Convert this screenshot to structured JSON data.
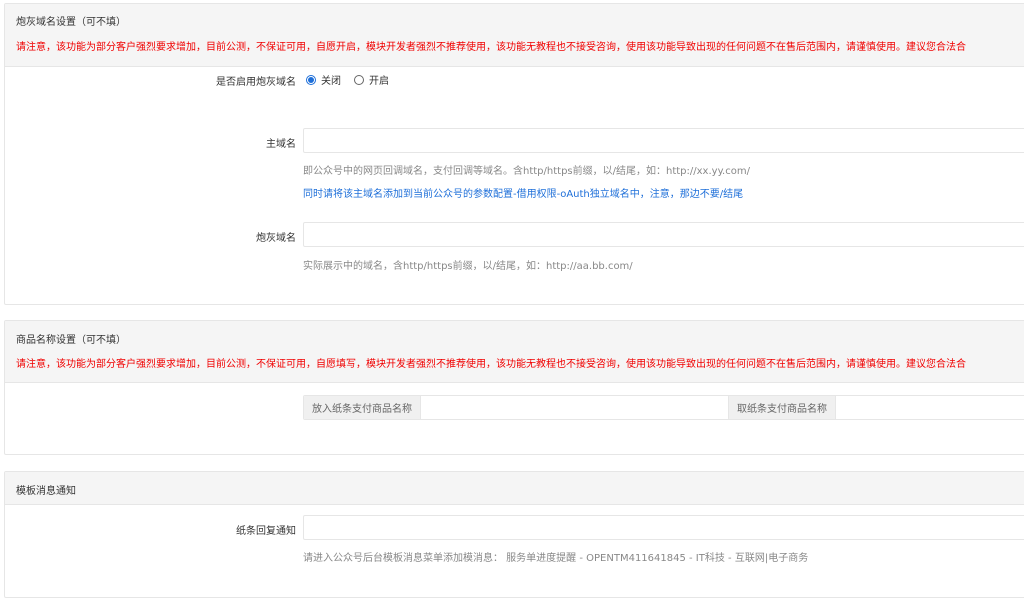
{
  "colors": {
    "warning": "#f00000",
    "note_blue": "#1e6fd9",
    "help_gray": "#888888",
    "header_bg": "#f5f5f5",
    "border": "#e6e6e6"
  },
  "panels": [
    {
      "title": "炮灰域名设置（可不填）",
      "warning": "请注意，该功能为部分客户强烈要求增加，目前公测，不保证可用，自愿开启，模块开发者强烈不推荐使用，该功能无教程也不接受咨询，使用该功能导致出现的任何问题不在售后范围内，请谨慎使用。建议您合法合",
      "enable": {
        "label": "是否启用炮灰域名",
        "options": [
          "关闭",
          "开启"
        ],
        "selected": "关闭"
      },
      "main_domain": {
        "label": "主域名",
        "value": "",
        "help": "即公众号中的网页回调域名，支付回调等域名。含http/https前缀，以/结尾，如：http://xx.yy.com/",
        "note": "同时请将该主域名添加到当前公众号的参数配置-借用权限-oAuth独立域名中，注意，那边不要/结尾"
      },
      "fodder_domain": {
        "label": "炮灰域名",
        "value": "",
        "help": "实际展示中的域名，含http/https前缀，以/结尾，如：http://aa.bb.com/"
      }
    },
    {
      "title": "商品名称设置（可不填）",
      "warning": "请注意，该功能为部分客户强烈要求增加，目前公测，不保证可用，自愿填写，模块开发者强烈不推荐使用，该功能无教程也不接受咨询，使用该功能导致出现的任何问题不在售后范围内，请谨慎使用。建议您合法合",
      "put_addon": "放入纸条支付商品名称",
      "put_value": "",
      "take_addon": "取纸条支付商品名称",
      "take_value": ""
    },
    {
      "title": "模板消息通知",
      "reply": {
        "label": "纸条回复通知",
        "value": "",
        "help": "请进入公众号后台模板消息菜单添加模消息：  服务单进度提醒 - OPENTM411641845 - IT科技 - 互联网|电子商务"
      }
    }
  ]
}
